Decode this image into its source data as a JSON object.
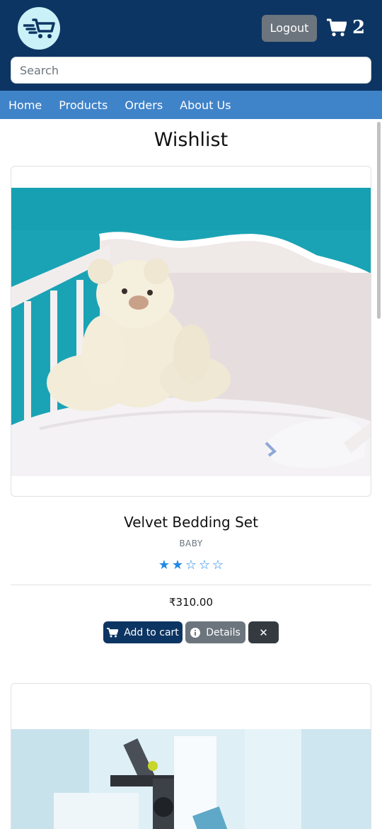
{
  "header": {
    "logout_label": "Logout",
    "cart_count": "2",
    "search_placeholder": "Search"
  },
  "nav": {
    "items": [
      {
        "label": "Home"
      },
      {
        "label": "Products"
      },
      {
        "label": "Orders"
      },
      {
        "label": "About Us"
      }
    ]
  },
  "page": {
    "title": "Wishlist"
  },
  "wishlist": [
    {
      "name": "Velvet Bedding Set",
      "category": "BABY",
      "rating": 2,
      "rating_max": 5,
      "price": "₹310.00",
      "add_to_cart_label": "Add to cart",
      "details_label": "Details",
      "remove_label": "✕"
    }
  ],
  "colors": {
    "header_bg": "#0d3563",
    "nav_bg": "#3f83c9",
    "star": "#1e88e5",
    "secondary": "#6c757d",
    "dark": "#343a40"
  },
  "icons": {
    "logo": "fast-cart-icon",
    "cart": "cart-icon",
    "info": "info-icon",
    "close": "close-icon"
  }
}
